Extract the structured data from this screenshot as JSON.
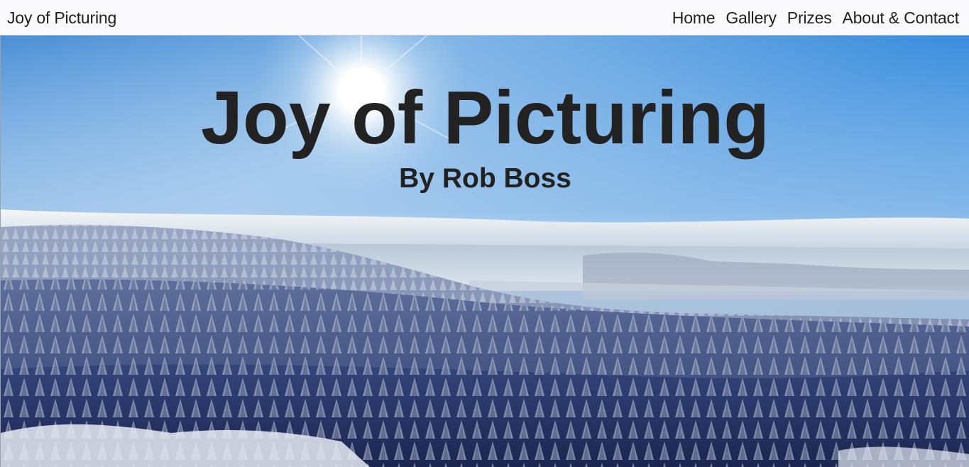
{
  "navbar": {
    "brand": "Joy of Picturing",
    "links": [
      {
        "label": "Home"
      },
      {
        "label": "Gallery"
      },
      {
        "label": "Prizes"
      },
      {
        "label": "About & Contact"
      }
    ],
    "background": "#fafafc"
  },
  "hero": {
    "title": "Joy of Picturing",
    "subtitle": "By Rob Boss",
    "text_color": "#222222",
    "image": "snowy-forest-landscape-with-sun"
  }
}
